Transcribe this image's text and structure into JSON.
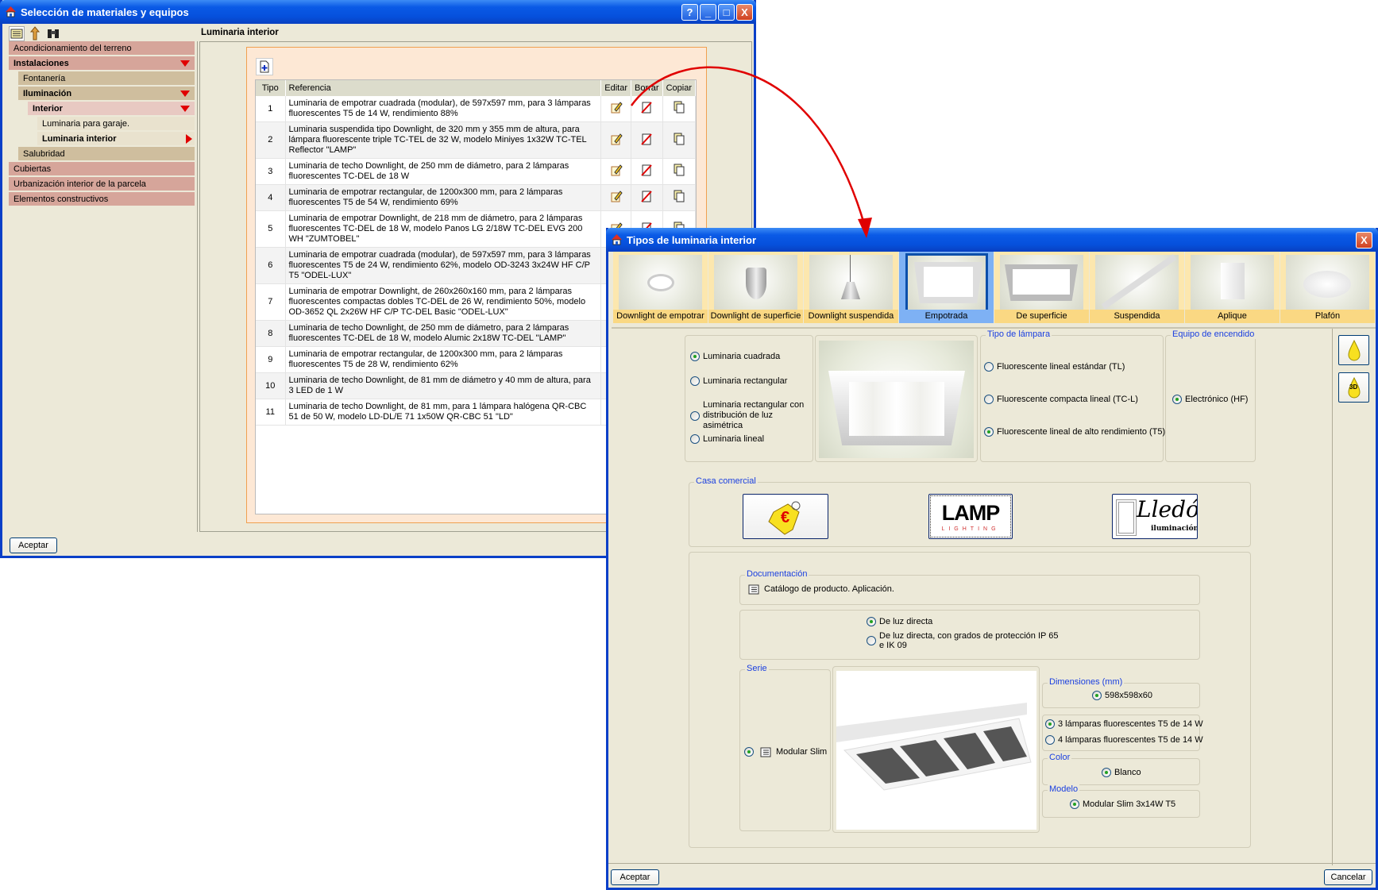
{
  "main_window": {
    "title": "Selección de materiales y equipos",
    "title_buttons": {
      "help": "?",
      "minimize": "_",
      "maximize": "□",
      "close": "X"
    },
    "panel_title": "Luminaria interior",
    "sidebar": [
      {
        "label": "Acondicionamiento del terreno"
      },
      {
        "label": "Instalaciones"
      },
      {
        "label": "Fontanería"
      },
      {
        "label": "Iluminación"
      },
      {
        "label": "Interior"
      },
      {
        "label": "Luminaria para garaje."
      },
      {
        "label": "Luminaria interior"
      },
      {
        "label": "Salubridad"
      },
      {
        "label": "Cubiertas"
      },
      {
        "label": "Urbanización interior de la parcela"
      },
      {
        "label": "Elementos constructivos"
      }
    ],
    "table": {
      "headers": {
        "tipo": "Tipo",
        "referencia": "Referencia",
        "editar": "Editar",
        "borrar": "Borrar",
        "copiar": "Copiar"
      },
      "rows": [
        {
          "tipo": "1",
          "ref": "Luminaria de empotrar cuadrada (modular), de 597x597 mm, para 3 lámparas fluorescentes T5 de 14 W, rendimiento 88%"
        },
        {
          "tipo": "2",
          "ref": "Luminaria suspendida tipo Downlight, de 320 mm y 355 mm de altura, para lámpara fluorescente triple TC-TEL de 32 W, modelo Miniyes 1x32W TC-TEL Reflector \"LAMP\""
        },
        {
          "tipo": "3",
          "ref": "Luminaria de techo Downlight, de 250 mm de diámetro, para 2 lámparas fluorescentes TC-DEL de 18 W"
        },
        {
          "tipo": "4",
          "ref": "Luminaria de empotrar rectangular, de 1200x300 mm, para 2 lámparas fluorescentes T5 de 54 W, rendimiento 69%"
        },
        {
          "tipo": "5",
          "ref": "Luminaria de empotrar Downlight, de 218 mm de diámetro, para 2 lámparas fluorescentes TC-DEL de 18 W, modelo Panos LG 2/18W TC-DEL EVG 200 WH \"ZUMTOBEL\""
        },
        {
          "tipo": "6",
          "ref": "Luminaria de empotrar cuadrada (modular), de 597x597 mm, para 3 lámparas fluorescentes T5 de 24 W, rendimiento 62%, modelo OD-3243 3x24W HF C/P T5 \"ODEL-LUX\""
        },
        {
          "tipo": "7",
          "ref": "Luminaria de empotrar Downlight, de 260x260x160 mm, para 2 lámparas fluorescentes compactas dobles TC-DEL de 26 W, rendimiento 50%, modelo OD-3652 QL 2x26W HF C/P TC-DEL Basic \"ODEL-LUX\""
        },
        {
          "tipo": "8",
          "ref": "Luminaria de techo Downlight, de 250 mm de diámetro, para 2 lámparas fluorescentes TC-DEL de 18 W, modelo Alumic 2x18W TC-DEL \"LAMP\""
        },
        {
          "tipo": "9",
          "ref": "Luminaria de empotrar rectangular, de 1200x300 mm, para 2 lámparas fluorescentes T5 de 28 W, rendimiento 62%"
        },
        {
          "tipo": "10",
          "ref": "Luminaria de techo Downlight, de 81 mm de diámetro y 40 mm de altura, para 3 LED de 1 W"
        },
        {
          "tipo": "11",
          "ref": "Luminaria de techo Downlight, de 81 mm, para 1 lámpara halógena QR-CBC 51 de 50 W, modelo LD-DL/E 71 1x50W QR-CBC 51 \"LD\""
        }
      ]
    },
    "accept_label": "Aceptar"
  },
  "dialog": {
    "title": "Tipos de luminaria interior",
    "close": "X",
    "types": [
      {
        "label": "Downlight de empotrar"
      },
      {
        "label": "Downlight de superficie"
      },
      {
        "label": "Downlight suspendida"
      },
      {
        "label": "Empotrada",
        "selected": true
      },
      {
        "label": "De superficie"
      },
      {
        "label": "Suspendida"
      },
      {
        "label": "Aplique"
      },
      {
        "label": "Plafón"
      }
    ],
    "shape": {
      "options": [
        "Luminaria cuadrada",
        "Luminaria rectangular",
        "Luminaria rectangular con distribución de luz asimétrica",
        "Luminaria lineal"
      ],
      "selected": 0
    },
    "lamp_type": {
      "title": "Tipo de lámpara",
      "options": [
        "Fluorescente lineal estándar (TL)",
        "Fluorescente compacta lineal (TC-L)",
        "Fluorescente lineal de alto rendimiento (T5)"
      ],
      "selected": 2
    },
    "ignition": {
      "title": "Equipo de encendido",
      "option": "Electrónico (HF)"
    },
    "side_buttons": {
      "view3d": "3D"
    },
    "brand": {
      "title": "Casa comercial",
      "logos": [
        "€",
        "LAMP",
        "LIGHTING",
        "Lledó",
        "iluminación"
      ]
    },
    "documentation": {
      "title": "Documentación",
      "item": "Catálogo de producto. Aplicación."
    },
    "light": {
      "options": [
        "De luz directa",
        "De luz directa, con grados de protección IP 65 e IK 09"
      ],
      "selected": 0
    },
    "series": {
      "title": "Serie",
      "option": "Modular Slim"
    },
    "dimensions": {
      "title": "Dimensiones (mm)",
      "option": "598x598x60"
    },
    "lamps": {
      "options": [
        "3 lámparas fluorescentes T5 de 14 W",
        "4 lámparas fluorescentes T5 de 14 W"
      ],
      "selected": 0
    },
    "color": {
      "title": "Color",
      "option": "Blanco"
    },
    "model": {
      "title": "Modelo",
      "option": "Modular Slim 3x14W T5"
    },
    "accept_label": "Aceptar",
    "cancel_label": "Cancelar"
  },
  "colors": {
    "titlebar": "#0A5AE6",
    "arrow": "#E00000",
    "group_label": "#1A3FE0",
    "selected_tile": "#7EB1F4"
  }
}
